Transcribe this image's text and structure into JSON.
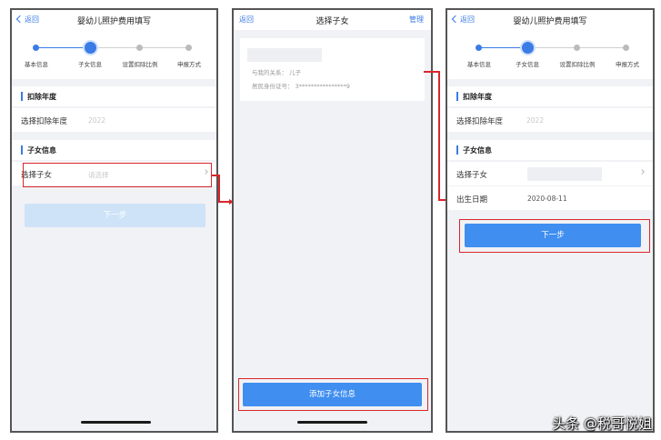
{
  "screen1": {
    "back_label": "返回",
    "title": "婴幼儿照护费用填写",
    "steps": [
      "基本信息",
      "子女信息",
      "设置扣除比例",
      "申报方式"
    ],
    "section_year": "扣除年度",
    "year_label": "选择扣除年度",
    "year_value": "2022",
    "section_child": "子女信息",
    "child_label": "选择子女",
    "child_placeholder": "请选择",
    "next_label": "下一步"
  },
  "screen2": {
    "back_label": "返回",
    "title": "选择子女",
    "manage_label": "管理",
    "relation_text": "与我的关系： 儿子",
    "id_text": "居民身份证号： 3****************9",
    "add_button": "添加子女信息"
  },
  "screen3": {
    "back_label": "返回",
    "title": "婴幼儿照护费用填写",
    "steps": [
      "基本信息",
      "子女信息",
      "设置扣除比例",
      "申报方式"
    ],
    "section_year": "扣除年度",
    "year_label": "选择扣除年度",
    "year_value": "2022",
    "section_child": "子女信息",
    "child_label": "选择子女",
    "birth_label": "出生日期",
    "birth_value": "2020-08-11",
    "next_label": "下一步"
  },
  "watermark": "头条 @税哥悦姐",
  "colors": {
    "accent": "#3a7be6",
    "button_primary": "#3f8ef0",
    "button_disabled": "#cfe3f8",
    "highlight": "#d9262a",
    "background": "#f1f2f5"
  }
}
